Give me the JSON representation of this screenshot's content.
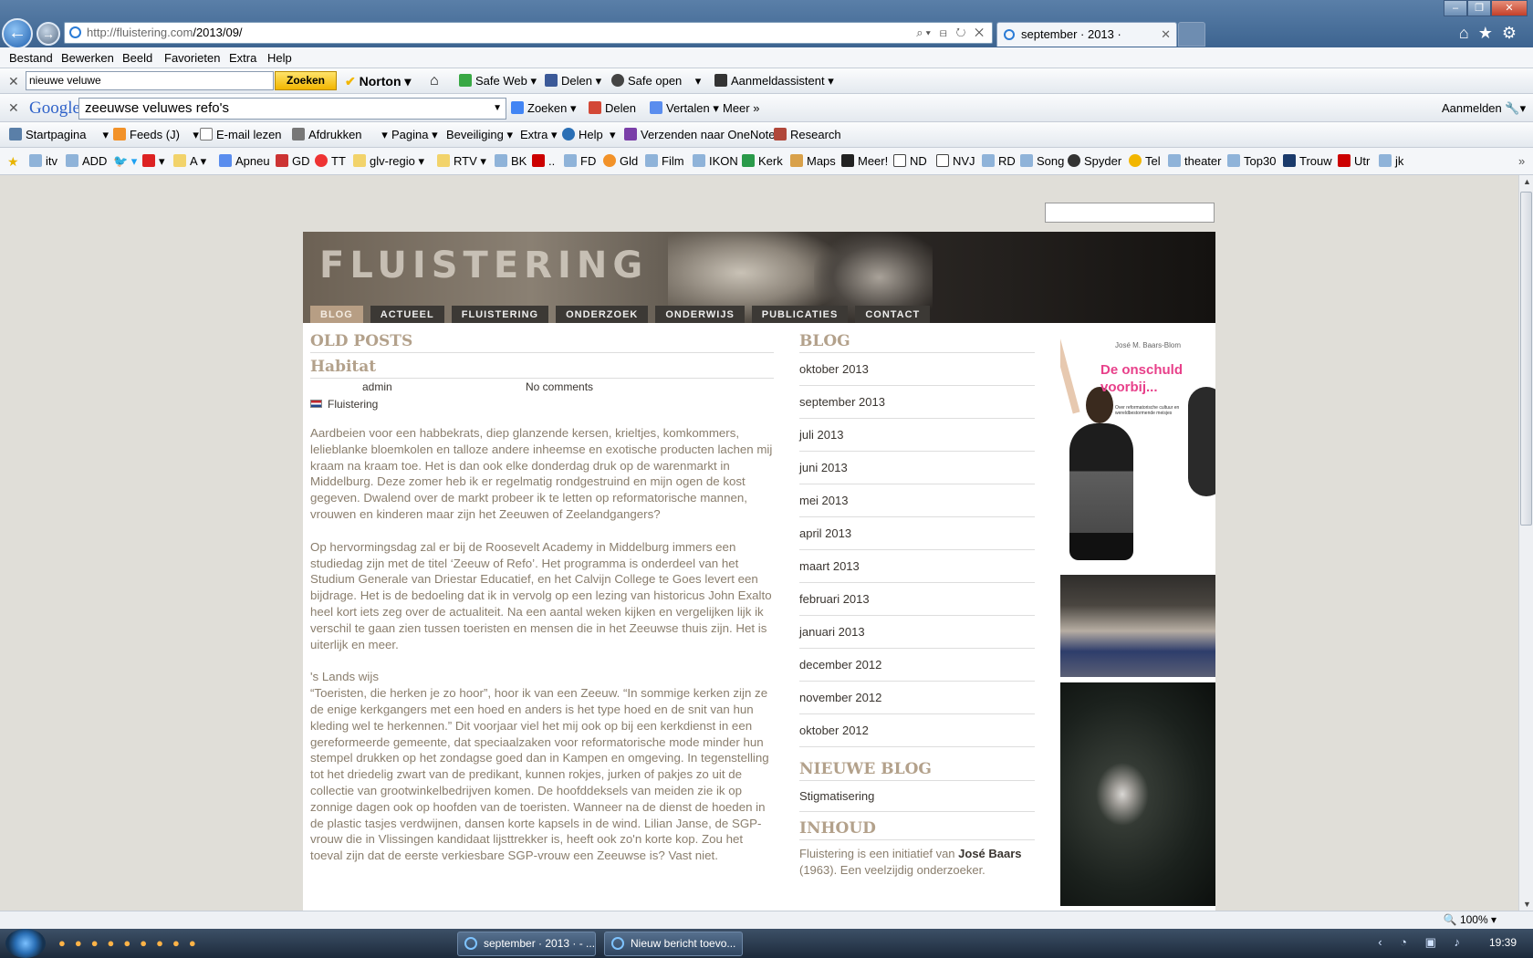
{
  "browser": {
    "url_domain": "http://fluistering.com",
    "url_path": "/2013/09/",
    "tab_title": "september · 2013 ·",
    "zoom": "100%"
  },
  "menubar": [
    "Bestand",
    "Bewerken",
    "Beeld",
    "Favorieten",
    "Extra",
    "Help"
  ],
  "norton": {
    "search_value": "nieuwe veluwe",
    "search_button": "Zoeken",
    "brand": "Norton",
    "safe_web": "Safe Web",
    "delen": "Delen",
    "safe_open": "Safe open",
    "aanmeld": "Aanmeldassistent"
  },
  "google": {
    "logo": "Google",
    "query": "zeeuwse veluwes refo's",
    "zoeken": "Zoeken",
    "delen": "Delen",
    "vertalen": "Vertalen",
    "meer": "Meer",
    "aanmelden": "Aanmelden"
  },
  "commandbar": {
    "start": "Startpagina",
    "feeds": "Feeds (J)",
    "email": "E-mail lezen",
    "print": "Afdrukken",
    "pagina": "Pagina",
    "beveiliging": "Beveiliging",
    "extra": "Extra",
    "help": "Help",
    "onenote": "Verzenden naar OneNote",
    "research": "Research"
  },
  "favorites": [
    "itv",
    "ADD",
    "A",
    "Apneu",
    "GD",
    "TT",
    "glv-regio",
    "RTV",
    "BK",
    "..",
    "FD",
    "Gld",
    "Film",
    "IKON",
    "Kerk",
    "Maps",
    "Meer!",
    "ND",
    "NVJ",
    "RD",
    "Song",
    "Spyder",
    "Tel",
    "theater",
    "Top30",
    "Trouw",
    "Utr",
    "jk"
  ],
  "site": {
    "logo": "FLUISTERING",
    "nav": [
      "BLOG",
      "ACTUEEL",
      "FLUISTERING",
      "ONDERZOEK",
      "ONDERWIJS",
      "PUBLICATIES",
      "CONTACT"
    ],
    "old_posts": "OLD POSTS",
    "post_title": "Habitat",
    "author": "admin",
    "comments": "No comments",
    "category": "Fluistering",
    "paragraphs": [
      "Aardbeien voor een habbekrats, diep glanzende kersen, krieltjes, komkommers, lelieblanke bloemkolen en talloze andere inheemse en exotische producten lachen mij kraam na kraam toe. Het is dan ook elke donderdag druk op de warenmarkt in Middelburg. Deze zomer heb ik er regelmatig rondgestruind en mijn ogen de kost gegeven. Dwalend over de markt probeer ik te letten op reformatorische mannen, vrouwen en kinderen maar zijn het Zeeuwen of Zeelandgangers?",
      "Op hervormingsdag zal er bij de Roosevelt Academy in Middelburg immers een studiedag zijn met de titel ‘Zeeuw of Refo’. Het programma is onderdeel van het Studium Generale van Driestar Educatief, en het Calvijn College te Goes levert een bijdrage. Het is de bedoeling dat ik in vervolg op een lezing van historicus John Exalto heel kort iets zeg over de actualiteit. Na een aantal weken kijken en vergelijken lijk ik verschil te gaan zien tussen toeristen en mensen die in het Zeeuwse thuis zijn. Het is uiterlijk en meer."
    ],
    "subhead": "'s Lands wijs",
    "paragraph3": "“Toeristen, die herken je zo hoor”, hoor ik van een Zeeuw. “In sommige kerken zijn ze de enige kerkgangers met een hoed en anders is het type hoed en de snit van hun kleding wel te herkennen.” Dit voorjaar viel het mij ook op bij een kerkdienst in een gereformeerde gemeente, dat speciaalzaken voor reformatorische mode minder hun stempel drukken op het zondagse goed dan in Kampen en omgeving. In tegenstelling tot het driedelig zwart van de predikant, kunnen rokjes, jurken of pakjes zo uit de collectie van grootwinkelbedrijven komen. De hoofddeksels van meiden zie ik op zonnige dagen ook op hoofden van de toeristen. Wanneer na de dienst de hoeden in de plastic tasjes verdwijnen, dansen korte kapsels in de wind. Lilian Janse, de SGP-vrouw die in Vlissingen kandidaat lijsttrekker is, heeft ook zo'n korte kop. Zou het toeval zijn dat de eerste verkiesbare SGP-vrouw een Zeeuwse is? Vast niet.",
    "blog_heading": "BLOG",
    "archive": [
      "oktober 2013",
      "september 2013",
      "juli 2013",
      "juni 2013",
      "mei 2013",
      "april 2013",
      "maart 2013",
      "februari 2013",
      "januari 2013",
      "december 2012",
      "november 2012",
      "oktober 2012"
    ],
    "new_blog_heading": "NIEUWE BLOG",
    "new_blog_item": "Stigmatisering",
    "inhoud_heading": "INHOUD",
    "inhoud_pre": "Fluistering is een initiatief van ",
    "inhoud_name": "José Baars",
    "inhoud_post": " (1963). Een veelzijdig onderzoeker.",
    "book_author": "José M. Baars-Blom",
    "book_title": "De onschuld voorbij...",
    "book_subtitle": "Over reformatorische cultuur en wereldbestormende meisjes"
  },
  "taskbar": {
    "btn1": "september · 2013 · - ...",
    "btn2": "Nieuw bericht toevo...",
    "time": "19:39"
  }
}
